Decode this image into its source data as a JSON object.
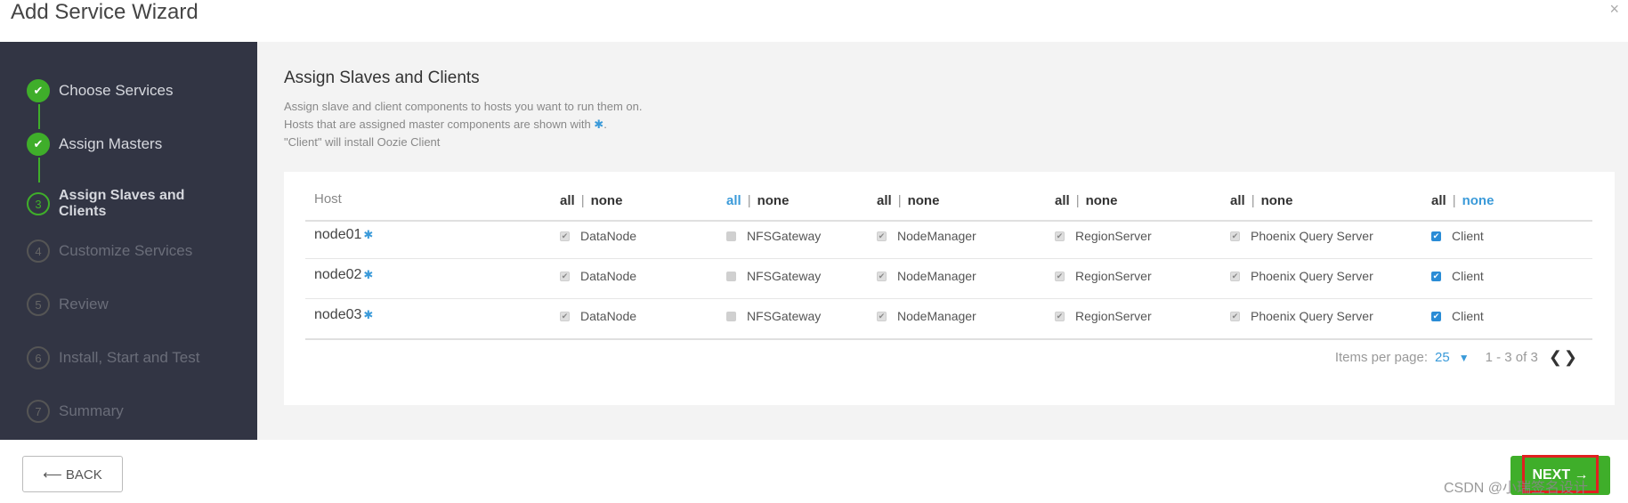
{
  "dialog": {
    "title": "Add Service Wizard",
    "close_glyph": "×"
  },
  "steps": [
    {
      "num": "✔",
      "label": "Choose Services",
      "state": "done"
    },
    {
      "num": "✔",
      "label": "Assign Masters",
      "state": "done"
    },
    {
      "num": "3",
      "label": "Assign Slaves and Clients",
      "state": "active"
    },
    {
      "num": "4",
      "label": "Customize Services",
      "state": "todo"
    },
    {
      "num": "5",
      "label": "Review",
      "state": "todo"
    },
    {
      "num": "6",
      "label": "Install, Start and Test",
      "state": "todo"
    },
    {
      "num": "7",
      "label": "Summary",
      "state": "todo"
    }
  ],
  "main": {
    "title": "Assign Slaves and Clients",
    "desc_line1": "Assign slave and client components to hosts you want to run them on.",
    "desc_line2": "Hosts that are assigned master components are shown with ",
    "desc_star": "✱",
    "desc_line2_end": ".",
    "desc_line3": "\"Client\" will install Oozie Client"
  },
  "table": {
    "host_header": "Host",
    "columns": [
      {
        "all": "all",
        "none": "none",
        "sep": "|",
        "all_active": false,
        "none_active": false
      },
      {
        "all": "all",
        "none": "none",
        "sep": "|",
        "all_active": true,
        "none_active": false
      },
      {
        "all": "all",
        "none": "none",
        "sep": "|",
        "all_active": false,
        "none_active": false
      },
      {
        "all": "all",
        "none": "none",
        "sep": "|",
        "all_active": false,
        "none_active": false
      },
      {
        "all": "all",
        "none": "none",
        "sep": "|",
        "all_active": false,
        "none_active": false
      },
      {
        "all": "all",
        "none": "none",
        "sep": "|",
        "all_active": false,
        "none_active": true
      }
    ],
    "rows": [
      {
        "host": "node01",
        "star": "✱",
        "cells": [
          "DataNode",
          "NFSGateway",
          "NodeManager",
          "RegionServer",
          "Phoenix Query Server",
          "Client"
        ]
      },
      {
        "host": "node02",
        "star": "✱",
        "cells": [
          "DataNode",
          "NFSGateway",
          "NodeManager",
          "RegionServer",
          "Phoenix Query Server",
          "Client"
        ]
      },
      {
        "host": "node03",
        "star": "✱",
        "cells": [
          "DataNode",
          "NFSGateway",
          "NodeManager",
          "RegionServer",
          "Phoenix Query Server",
          "Client"
        ]
      }
    ],
    "cell_states": [
      "checked-disabled",
      "unchecked-disabled",
      "checked-disabled",
      "checked-disabled",
      "checked-disabled",
      "checked"
    ]
  },
  "pager": {
    "items_label": "Items per page:",
    "per_page": "25",
    "range": "1 - 3 of 3",
    "prev_next": "❮❯"
  },
  "footer": {
    "back_label": "⟵ BACK",
    "next_label": "NEXT →",
    "watermark": "CSDN @小瑞签名设计"
  },
  "colors": {
    "accent_green": "#3fae2a",
    "link_blue": "#3a9ad9",
    "sidebar_bg": "#323544",
    "highlight_red": "#e02020"
  }
}
